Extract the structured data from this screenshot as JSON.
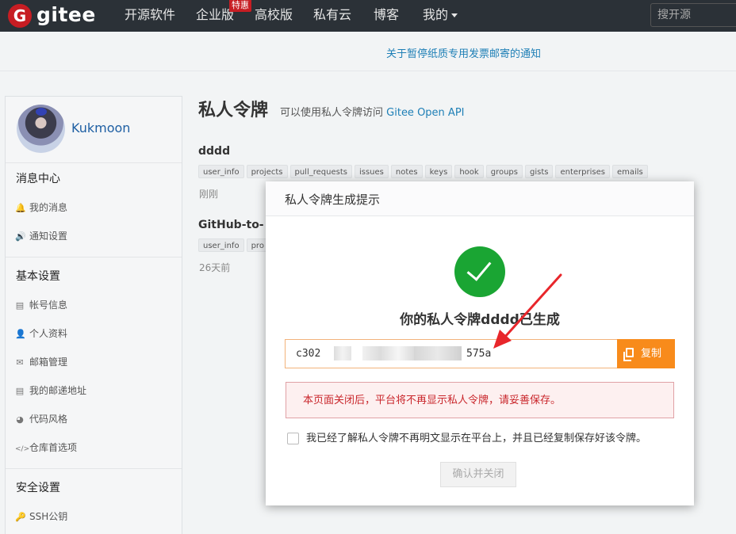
{
  "nav": {
    "logo_letter": "G",
    "brand": "gitee",
    "items": [
      "开源软件",
      "企业版",
      "高校版",
      "私有云",
      "博客",
      "我的"
    ],
    "badge": "特惠",
    "search_placeholder": "搜开源"
  },
  "notice": {
    "text": "关于暂停纸质专用发票邮寄的通知"
  },
  "sidebar": {
    "username": "Kukmoon",
    "sections": [
      {
        "title": "消息中心",
        "items": [
          {
            "icon": "bell-icon",
            "glyph": "🔔",
            "label": "我的消息"
          },
          {
            "icon": "volume-icon",
            "glyph": "🔊",
            "label": "通知设置"
          }
        ]
      },
      {
        "title": "基本设置",
        "items": [
          {
            "icon": "id-card-icon",
            "glyph": "▤",
            "label": "帐号信息"
          },
          {
            "icon": "user-icon",
            "glyph": "👤",
            "label": "个人资料"
          },
          {
            "icon": "envelope-icon",
            "glyph": "✉",
            "label": "邮箱管理"
          },
          {
            "icon": "address-card-icon",
            "glyph": "▤",
            "label": "我的邮递地址"
          },
          {
            "icon": "palette-icon",
            "glyph": "◕",
            "label": "代码风格"
          },
          {
            "icon": "code-icon",
            "glyph": "</>",
            "label": "仓库首选项"
          }
        ]
      },
      {
        "title": "安全设置",
        "items": [
          {
            "icon": "key-icon",
            "glyph": "🔑",
            "label": "SSH公钥"
          }
        ]
      }
    ]
  },
  "main": {
    "title": "私人令牌",
    "subtitle_prefix": "可以使用私人令牌访问",
    "subtitle_link": "Gitee Open API",
    "tokens": [
      {
        "name": "dddd",
        "scopes": [
          "user_info",
          "projects",
          "pull_requests",
          "issues",
          "notes",
          "keys",
          "hook",
          "groups",
          "gists",
          "enterprises",
          "emails"
        ],
        "time": "刚刚"
      },
      {
        "name": "GitHub-to-",
        "scopes": [
          "user_info",
          "pro"
        ],
        "time": "26天前"
      }
    ]
  },
  "modal": {
    "title": "私人令牌生成提示",
    "success": "你的私人令牌dddd已生成",
    "token_prefix": "c302",
    "token_suffix": "575a",
    "copy_label": "复制",
    "warning": "本页面关闭后，平台将不再显示私人令牌，请妥善保存。",
    "confirm_text": "我已经了解私人令牌不再明文显示在平台上，并且已经复制保存好该令牌。",
    "confirm_button": "确认并关闭"
  },
  "colors": {
    "nav_bg": "#2b3137",
    "brand_red": "#c71d23",
    "success_green": "#1aa533",
    "copy_orange": "#f88b1b",
    "warning_red": "#c9262b",
    "arrow_red": "#e8262b"
  }
}
